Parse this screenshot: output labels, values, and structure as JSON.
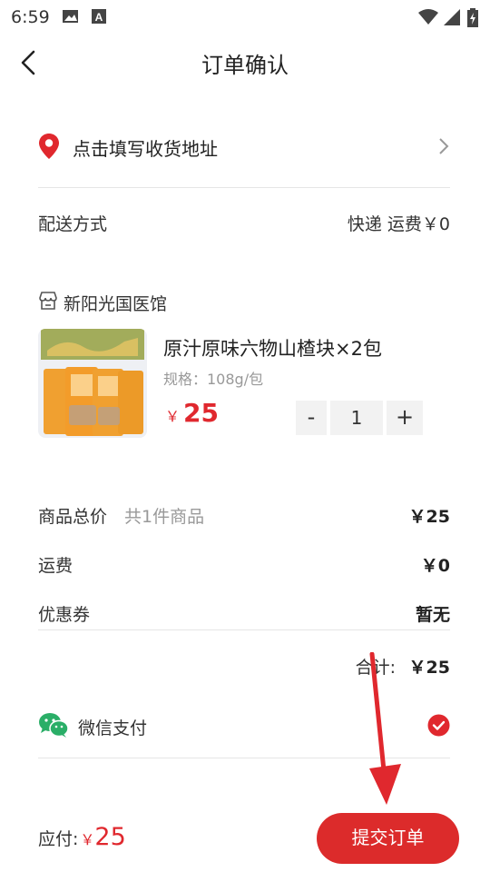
{
  "status_bar": {
    "time": "6:59"
  },
  "header": {
    "title": "订单确认"
  },
  "address": {
    "placeholder": "点击填写收货地址"
  },
  "shipping": {
    "label": "配送方式",
    "value": "快递 运费￥0"
  },
  "shop": {
    "name": "新阳光国医馆"
  },
  "product": {
    "name": "原汁原味六物山楂块×2包",
    "spec": "规格：108g/包",
    "currency": "￥",
    "price": "25",
    "quantity": "1",
    "minus_label": "-",
    "plus_label": "+"
  },
  "summary": {
    "goods_total_label": "商品总价",
    "goods_count": "共1件商品",
    "goods_total_value": "￥25",
    "freight_label": "运费",
    "freight_value": "￥0",
    "coupon_label": "优惠券",
    "coupon_value": "暂无",
    "total_label": "合计:",
    "total_value": "￥25"
  },
  "payment": {
    "method": "微信支付",
    "selected": true
  },
  "footer": {
    "due_label": "应付:",
    "due_currency": "￥",
    "due_amount": "25",
    "submit_label": "提交订单"
  },
  "colors": {
    "accent": "#dc2b2b",
    "price": "#e0282e",
    "wechat": "#2aae67"
  },
  "icons": [
    "image-icon",
    "text-a-icon",
    "wifi-icon",
    "signal-icon",
    "battery-icon",
    "back-icon",
    "location-pin-icon",
    "chevron-right-icon",
    "store-icon",
    "wechat-icon",
    "check-circle-icon"
  ]
}
